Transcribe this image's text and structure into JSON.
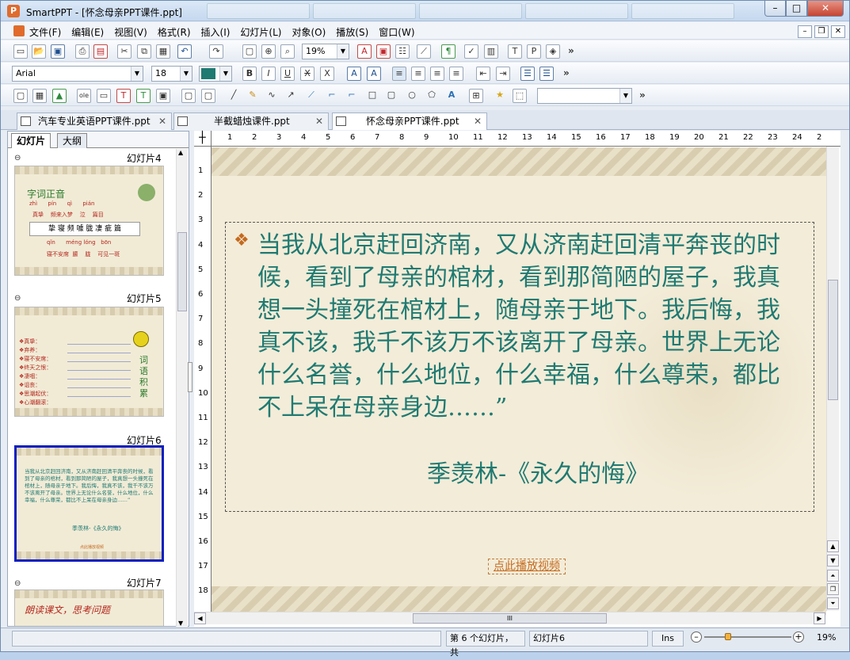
{
  "window": {
    "title": "SmartPPT - [怀念母亲PPT课件.ppt]",
    "app_icon_letter": "P",
    "min": "–",
    "max": "□",
    "close": "✕"
  },
  "menu": [
    "文件(F)",
    "编辑(E)",
    "视图(V)",
    "格式(R)",
    "插入(I)",
    "幻灯片(L)",
    "对象(O)",
    "播放(S)",
    "窗口(W)"
  ],
  "mdi": {
    "min": "–",
    "restore": "❐",
    "close": "✕"
  },
  "toolbar": {
    "zoom_value": "19%",
    "font_name": "Arial",
    "font_size": "18",
    "font_color": "#1f7a72",
    "more": "»"
  },
  "doc_tabs": [
    {
      "label": "汽车专业英语PPT课件.ppt",
      "close": "✕"
    },
    {
      "label": "半截蜡烛课件.ppt",
      "close": "✕"
    },
    {
      "label": "怀念母亲PPT课件.ppt",
      "close": "✕"
    }
  ],
  "panel": {
    "tabs": [
      "幻灯片",
      "大纲"
    ],
    "slides": [
      {
        "label": "幻灯片4",
        "title": "字词正音",
        "pinyin1": "zhì      pín      qì      pián",
        "words1": "真挚    频来入梦    泣    篇目",
        "chars": "挚 寝 频 噱 胧 凄 疵 篇",
        "pinyin2": "qǐn      méng lóng   bōn",
        "words2": "寝不安席  朦    胧    可见一斑"
      },
      {
        "label": "幻灯片5",
        "lines": [
          "❖真挚：",
          "❖弃养：",
          "❖寝不安席：",
          "❖终天之恨：",
          "❖凄咽：",
          "❖诅丧：",
          "❖思潮起伏：",
          "❖心潮翻滚："
        ],
        "side": "词语积累"
      },
      {
        "label": "幻灯片6",
        "text": "当我从北京赶回济南，又从济南赶回清平奔丧的时候，看到了母亲的棺材，看到那简陋的屋子，我真想一头撞死在棺材上，随母亲于地下。我后悔，我真不该，我千不该万不该离开了母亲。世界上无论什么名誉，什么地位，什么幸福，什么尊荣，都比不上呆在母亲身边……”",
        "author": "季羡林-《永久的悔》",
        "link": "点此播放视频"
      },
      {
        "label": "幻灯片7",
        "title": "朗读课文，思考问题"
      }
    ]
  },
  "slide": {
    "bullet": "❖",
    "text": "当我从北京赶回济南，又从济南赶回清平奔丧的时候，看到了母亲的棺材，看到那简陋的屋子，我真想一头撞死在棺材上，随母亲于地下。我后悔，我真不该，我千不该万不该离开了母亲。世界上无论什么名誉，什么地位，什么幸福，什么尊荣，都比不上呆在母亲身边……”",
    "author": "季羡林-《永久的悔》",
    "video_link": "点此播放视频"
  },
  "rulers": {
    "h": [
      "1",
      "2",
      "3",
      "4",
      "5",
      "6",
      "7",
      "8",
      "9",
      "10",
      "11",
      "12",
      "13",
      "14",
      "15",
      "16",
      "17",
      "18",
      "19",
      "20",
      "21",
      "22",
      "23",
      "24",
      "2"
    ],
    "v": [
      "1",
      "2",
      "3",
      "4",
      "5",
      "6",
      "7",
      "8",
      "9",
      "10",
      "11",
      "12",
      "13",
      "14",
      "15",
      "16",
      "17",
      "18"
    ]
  },
  "status": {
    "slide_info": "第 6 个幻灯片，共",
    "slide_name": "幻灯片6",
    "mode": "Ins",
    "zoom": "19%",
    "zoom_in": "+",
    "zoom_out": "–"
  },
  "scroll": {
    "grip": "III"
  }
}
